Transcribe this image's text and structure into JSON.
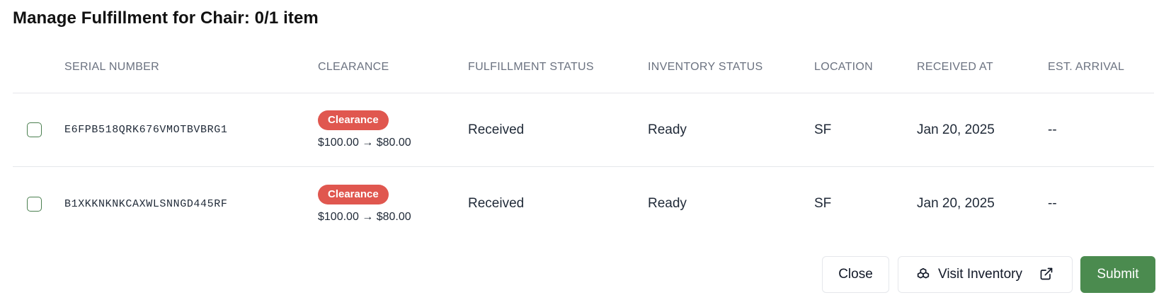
{
  "title": "Manage Fulfillment for Chair: 0/1 item",
  "table": {
    "headers": {
      "serial": "SERIAL NUMBER",
      "clearance": "CLEARANCE",
      "fulfillment": "FULFILLMENT STATUS",
      "inventory": "INVENTORY STATUS",
      "location": "LOCATION",
      "received": "RECEIVED AT",
      "arrival": "EST. ARRIVAL"
    },
    "rows": [
      {
        "serial": "E6FPB518QRK676VMOTBVBRG1",
        "badge": "Clearance",
        "price": "$100.00 → $80.00",
        "fulfillment": "Received",
        "inventory": "Ready",
        "location": "SF",
        "received": "Jan 20, 2025",
        "arrival": "--"
      },
      {
        "serial": "B1XKKNKNKCAXWLSNNGD445RF",
        "badge": "Clearance",
        "price": "$100.00 → $80.00",
        "fulfillment": "Received",
        "inventory": "Ready",
        "location": "SF",
        "received": "Jan 20, 2025",
        "arrival": "--"
      }
    ]
  },
  "buttons": {
    "close": "Close",
    "visit": "Visit Inventory",
    "submit": "Submit"
  },
  "icons": {
    "visit_leading": "boxes-icon",
    "visit_trailing": "external-link-icon"
  },
  "colors": {
    "badge": "#e0574f",
    "submit": "#4b8b4f",
    "checkbox_border": "#4a7f4f"
  }
}
